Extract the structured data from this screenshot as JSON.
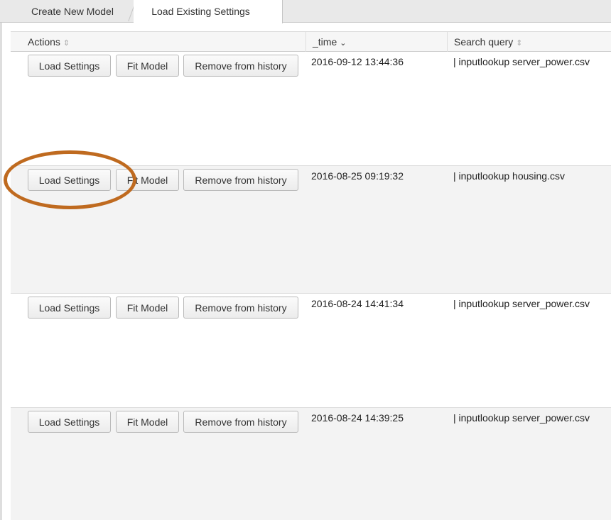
{
  "tabs": [
    {
      "label": "Create New Model",
      "active": false
    },
    {
      "label": "Load Existing Settings",
      "active": true
    }
  ],
  "table": {
    "headers": {
      "actions": "Actions",
      "time": "_time",
      "query": "Search query"
    },
    "buttons": {
      "load": "Load Settings",
      "fit": "Fit Model",
      "remove": "Remove from history"
    },
    "rows": [
      {
        "time": "2016-09-12 13:44:36",
        "query": "| inputlookup server_power.csv"
      },
      {
        "time": "2016-08-25 09:19:32",
        "query": "| inputlookup housing.csv"
      },
      {
        "time": "2016-08-24 14:41:34",
        "query": "| inputlookup server_power.csv"
      },
      {
        "time": "2016-08-24 14:39:25",
        "query": "| inputlookup server_power.csv"
      }
    ]
  },
  "icons": {
    "sort_neutral": "sort-icon",
    "sort_desc": "sort-desc-icon"
  },
  "colors": {
    "highlight": "#bf6a1f"
  }
}
